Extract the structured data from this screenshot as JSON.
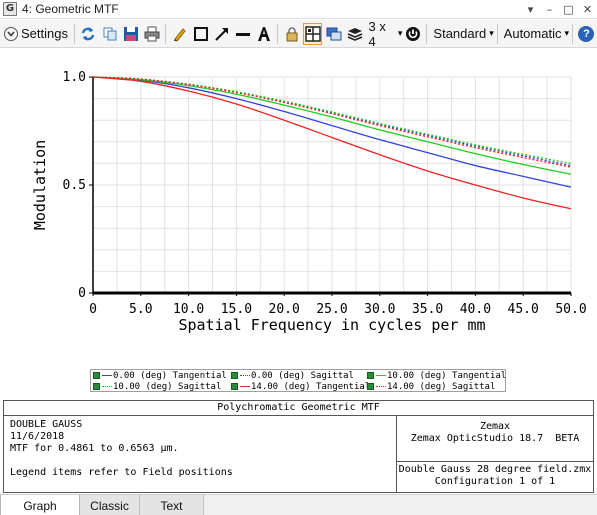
{
  "window": {
    "app_badge": "G",
    "title": "4: Geometric MTF",
    "controls": {
      "dropdown": "▾",
      "minimize": "–",
      "maximize": "□",
      "close": "✕"
    }
  },
  "toolbar": {
    "settings_label": "Settings",
    "layout_label": "3 x 4",
    "style_label": "Standard",
    "scale_label": "Automatic",
    "help_label": "?",
    "colors": {
      "refresh": "#1f6fc7",
      "save": "#1f5aa8",
      "pencil": "#e9a400",
      "accent": "#e49c22"
    }
  },
  "chart_data": {
    "type": "line",
    "xlabel": "Spatial Frequency in cycles per mm",
    "ylabel": "Modulation",
    "xlim": [
      0,
      50
    ],
    "ylim": [
      0,
      1
    ],
    "x_ticks": [
      "0",
      "5.0",
      "10.0",
      "15.0",
      "20.0",
      "25.0",
      "30.0",
      "35.0",
      "40.0",
      "45.0",
      "50.0"
    ],
    "x_tick_values": [
      0,
      5,
      10,
      15,
      20,
      25,
      30,
      35,
      40,
      45,
      50
    ],
    "y_ticks": [
      "0",
      "0.5",
      "1.0"
    ],
    "y_tick_values": [
      0,
      0.5,
      1.0
    ],
    "grid": true,
    "x": [
      0,
      5,
      10,
      15,
      20,
      25,
      30,
      35,
      40,
      45,
      50
    ],
    "series": [
      {
        "name": "0.00 (deg) Tangential",
        "color": "#3344dd",
        "dashed": false,
        "values": [
          1.0,
          0.985,
          0.95,
          0.9,
          0.84,
          0.775,
          0.71,
          0.65,
          0.59,
          0.54,
          0.49
        ]
      },
      {
        "name": "0.00 (deg) Sagittal",
        "color": "#3344dd",
        "dashed": true,
        "values": [
          1.0,
          0.99,
          0.965,
          0.93,
          0.885,
          0.835,
          0.78,
          0.73,
          0.68,
          0.635,
          0.59
        ]
      },
      {
        "name": "10.00 (deg) Tangential",
        "color": "#22cc22",
        "dashed": false,
        "values": [
          1.0,
          0.988,
          0.96,
          0.92,
          0.87,
          0.815,
          0.755,
          0.7,
          0.645,
          0.595,
          0.55
        ]
      },
      {
        "name": "10.00 (deg) Sagittal",
        "color": "#22cc22",
        "dashed": true,
        "values": [
          1.0,
          0.99,
          0.967,
          0.932,
          0.888,
          0.838,
          0.785,
          0.735,
          0.686,
          0.642,
          0.6
        ]
      },
      {
        "name": "14.00 (deg) Tangential",
        "color": "#ee2222",
        "dashed": false,
        "values": [
          1.0,
          0.98,
          0.935,
          0.875,
          0.8,
          0.72,
          0.64,
          0.565,
          0.5,
          0.44,
          0.39
        ]
      },
      {
        "name": "14.00 (deg) Sagittal",
        "color": "#ee2222",
        "dashed": true,
        "values": [
          1.0,
          0.99,
          0.965,
          0.928,
          0.882,
          0.83,
          0.775,
          0.723,
          0.673,
          0.627,
          0.583
        ]
      }
    ]
  },
  "legend": {
    "items": [
      {
        "label": "0.00 (deg) Tangential",
        "color": "#3344dd",
        "style": "solid"
      },
      {
        "label": "0.00 (deg) Sagittal",
        "color": "#3344dd",
        "style": "dotted"
      },
      {
        "label": "10.00 (deg) Tangential",
        "color": "#22cc22",
        "style": "solid"
      },
      {
        "label": "10.00 (deg) Sagittal",
        "color": "#22cc22",
        "style": "dotted"
      },
      {
        "label": "14.00 (deg) Tangential",
        "color": "#ee2222",
        "style": "solid"
      },
      {
        "label": "14.00 (deg) Sagittal",
        "color": "#ee2222",
        "style": "dotted"
      }
    ]
  },
  "info": {
    "title": "Polychromatic Geometric MTF",
    "lens_name": "DOUBLE GAUSS",
    "date": "11/6/2018",
    "wavelength": "MTF for 0.4861 to 0.6563 µm.",
    "legend_note": "Legend items refer to Field positions",
    "vendor": "Zemax",
    "product": "Zemax OpticStudio 18.7  BETA",
    "file": "Double Gauss 28 degree field.zmx",
    "configuration": "Configuration 1 of 1"
  },
  "tabs": [
    {
      "label": "Graph",
      "active": true
    },
    {
      "label": "Classic",
      "active": false
    },
    {
      "label": "Text",
      "active": false
    }
  ]
}
